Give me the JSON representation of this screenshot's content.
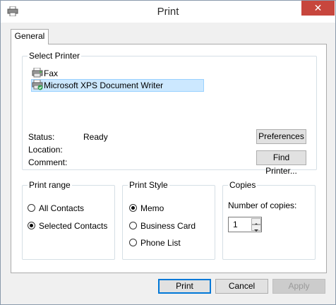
{
  "window": {
    "title": "Print",
    "close_glyph": "✕"
  },
  "tabs": [
    {
      "label": "General"
    }
  ],
  "select_printer": {
    "title": "Select Printer",
    "printers": [
      {
        "name": "Fax",
        "icon": "fax-icon"
      },
      {
        "name": "Microsoft XPS Document Writer",
        "icon": "printer-default-icon",
        "selected": true
      }
    ],
    "status_label": "Status:",
    "status_value": "Ready",
    "location_label": "Location:",
    "comment_label": "Comment:",
    "preferences_button": "Preferences",
    "find_printer_button": "Find Printer..."
  },
  "print_range": {
    "title": "Print range",
    "options": [
      {
        "label": "All Contacts",
        "checked": false
      },
      {
        "label": "Selected Contacts",
        "checked": true
      }
    ]
  },
  "print_style": {
    "title": "Print Style",
    "options": [
      {
        "label": "Memo",
        "checked": true
      },
      {
        "label": "Business Card",
        "checked": false
      },
      {
        "label": "Phone List",
        "checked": false
      }
    ]
  },
  "copies": {
    "title": "Copies",
    "number_label": "Number of copies:",
    "value": "1"
  },
  "footer": {
    "print_button": "Print",
    "cancel_button": "Cancel",
    "apply_button": "Apply"
  },
  "colors": {
    "close": "#c7463d",
    "selection_bg": "#cce8ff",
    "default_button_border": "#0078d7"
  }
}
